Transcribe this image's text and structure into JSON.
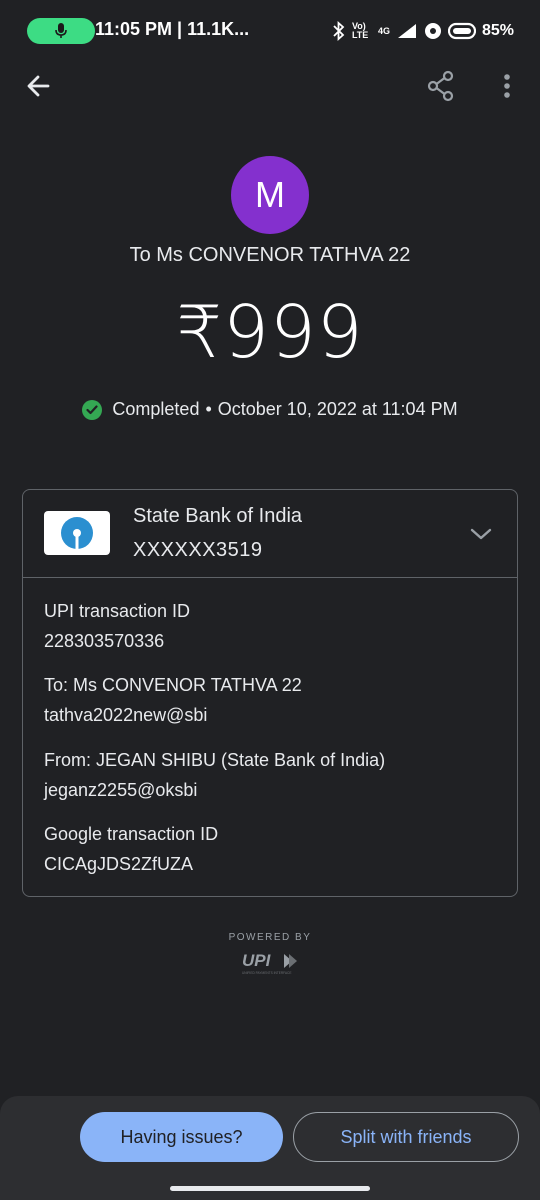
{
  "status_bar": {
    "text": "11:05 PM | 11.1K...",
    "volte_label": "Vo) LTE",
    "network_label": "4G",
    "battery": "85%"
  },
  "icons": {
    "back": "arrow-left-icon",
    "share": "share-icon",
    "more": "more-vert-icon",
    "mic": "mic-icon",
    "check": "check-circle-icon",
    "chevron": "chevron-down-icon"
  },
  "payment": {
    "avatar_letter": "M",
    "recipient": "To Ms CONVENOR  TATHVA 22",
    "amount": "₹999",
    "status": "Completed",
    "separator": "•",
    "datetime": "October 10, 2022 at 11:04 PM"
  },
  "bank": {
    "name": "State Bank of India",
    "account": "XXXXXX3519"
  },
  "details": [
    {
      "label": "UPI transaction ID",
      "value": "228303570336"
    },
    {
      "label": "To: Ms CONVENOR  TATHVA 22",
      "value": "tathva2022new@sbi"
    },
    {
      "label": "From: JEGAN  SHIBU (State Bank of India)",
      "value": "jeganz2255@oksbi"
    },
    {
      "label": "Google transaction ID",
      "value": "CICAgJDS2ZfUZA"
    }
  ],
  "footer": {
    "powered_by": "POWERED BY",
    "upi_logo_text": "UPI",
    "upi_tagline": "UNIFIED PAYMENTS INTERFACE"
  },
  "actions": {
    "issues_label": "Having issues?",
    "split_label": "Split with friends"
  },
  "colors": {
    "background": "#202124",
    "avatar": "#8430ce",
    "success": "#34a853",
    "primary": "#8ab4f8",
    "mic_pill": "#3ddc84"
  }
}
